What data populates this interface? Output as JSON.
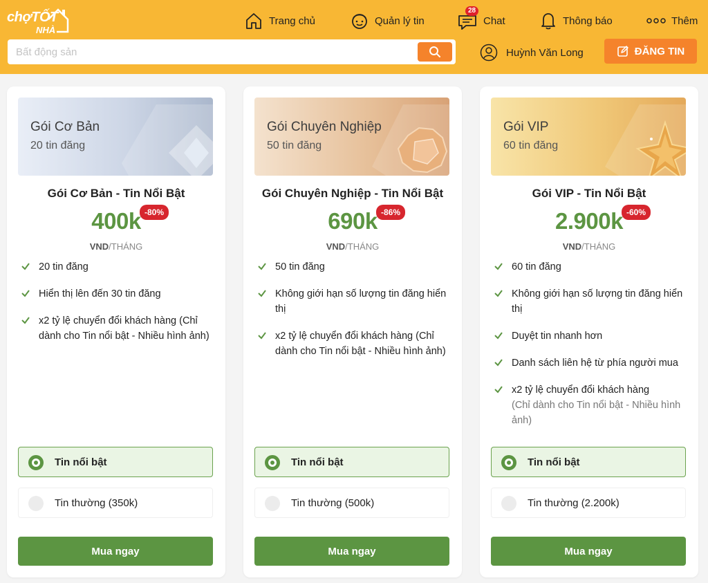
{
  "header": {
    "logo_top": "chợTỐT",
    "logo_bottom": "NHÀ",
    "nav": [
      {
        "label": "Trang chủ",
        "icon": "home-icon"
      },
      {
        "label": "Quản lý tin",
        "icon": "manage-icon"
      },
      {
        "label": "Chat",
        "icon": "chat-icon",
        "badge": "28"
      },
      {
        "label": "Thông báo",
        "icon": "bell-icon"
      },
      {
        "label": "Thêm",
        "icon": "more-icon"
      }
    ],
    "search_placeholder": "Bất động sản",
    "user_name": "Huỳnh Văn Long",
    "post_label": "ĐĂNG TIN"
  },
  "colors": {
    "header_bg": "#f8b734",
    "accent_orange": "#f5832b",
    "price_green": "#5c9542",
    "discount_red": "#d7262e"
  },
  "plans": [
    {
      "banner_title": "Gói Cơ Bản",
      "banner_sub": "20 tin đăng",
      "title": "Gói Cơ Bản - Tin Nổi Bật",
      "price": "400k",
      "discount": "-80%",
      "unit_a": "VND",
      "unit_b": "/THÁNG",
      "features": [
        {
          "text": "20 tin đăng"
        },
        {
          "text": "Hiển thị lên đến 30 tin đăng"
        },
        {
          "text": "x2 tỷ lệ chuyển đổi khách hàng (Chỉ dành cho Tin nổi bật - Nhiều hình ảnh)"
        }
      ],
      "option_selected": "Tin nổi bật",
      "option_normal": "Tin thường (350k)",
      "buy_label": "Mua ngay"
    },
    {
      "banner_title": "Gói Chuyên Nghiệp",
      "banner_sub": "50 tin đăng",
      "title": "Gói Chuyên Nghiệp - Tin Nổi Bật",
      "price": "690k",
      "discount": "-86%",
      "unit_a": "VND",
      "unit_b": "/THÁNG",
      "features": [
        {
          "text": "50 tin đăng"
        },
        {
          "text": "Không giới hạn số lượng tin đăng hiển thị"
        },
        {
          "text": "x2 tỷ lệ chuyển đổi khách hàng (Chỉ dành cho Tin nổi bật - Nhiều hình ảnh)"
        }
      ],
      "option_selected": "Tin nổi bật",
      "option_normal": "Tin thường (500k)",
      "buy_label": "Mua ngay"
    },
    {
      "banner_title": "Gói VIP",
      "banner_sub": "60 tin đăng",
      "title": "Gói VIP - Tin Nổi Bật",
      "price": "2.900k",
      "discount": "-60%",
      "unit_a": "VND",
      "unit_b": "/THÁNG",
      "features": [
        {
          "text": "60 tin đăng"
        },
        {
          "text": "Không giới hạn số lượng tin đăng hiển thị"
        },
        {
          "text": "Duyệt tin nhanh hơn"
        },
        {
          "text": "Danh sách liên hệ từ phía người mua"
        },
        {
          "text": "x2 tỷ lệ chuyển đổi khách hàng",
          "sub": "(Chỉ dành cho Tin nổi bật - Nhiều hình ảnh)"
        }
      ],
      "option_selected": "Tin nổi bật",
      "option_normal": "Tin thường (2.200k)",
      "buy_label": "Mua ngay"
    }
  ]
}
